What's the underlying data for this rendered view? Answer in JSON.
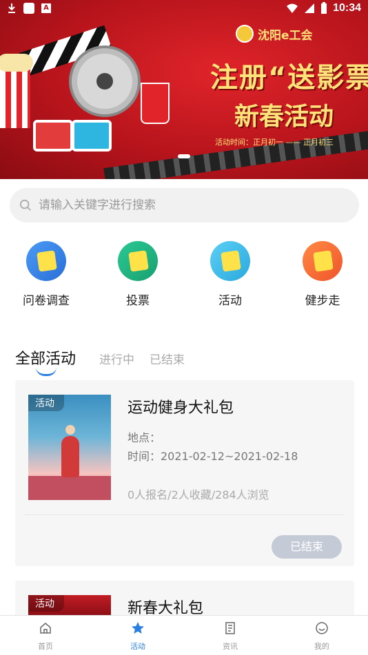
{
  "status_bar": {
    "time": "10:34",
    "notification_letter": "A"
  },
  "banner": {
    "org_name": "沈阳e工会",
    "headline": "注册“送影票”",
    "subheadline": "新春活动",
    "date_text": "活动时间：正月初一 —— 正月初三"
  },
  "search": {
    "placeholder": "请输入关键字进行搜索",
    "value": ""
  },
  "categories": [
    {
      "label": "问卷调查",
      "color_start": "#3f8ff0",
      "color_end": "#2a6fd8"
    },
    {
      "label": "投票",
      "color_start": "#27c08b",
      "color_end": "#17a070"
    },
    {
      "label": "活动",
      "color_start": "#4fc5ef",
      "color_end": "#2aa9de"
    },
    {
      "label": "健步走",
      "color_start": "#ff7b3a",
      "color_end": "#f0542a"
    }
  ],
  "tabs": {
    "all": "全部活动",
    "ongoing": "进行中",
    "ended": "已结束"
  },
  "activities": [
    {
      "tag": "活动",
      "title": "运动健身大礼包",
      "location": "地点：",
      "time": "时间：2021-02-12~2021-02-18",
      "stats": "0人报名/2人收藏/284人浏览",
      "status": "已结束"
    },
    {
      "tag": "活动",
      "title": "新春大礼包"
    }
  ],
  "tabbar": [
    {
      "label": "首页",
      "icon": "home-icon"
    },
    {
      "label": "活动",
      "icon": "star-icon",
      "active": true
    },
    {
      "label": "资讯",
      "icon": "news-icon"
    },
    {
      "label": "我的",
      "icon": "profile-icon"
    }
  ],
  "colors": {
    "accent": "#2a7fe0",
    "banner_red": "#c21c24",
    "ended_button": "#c4cbd6"
  }
}
